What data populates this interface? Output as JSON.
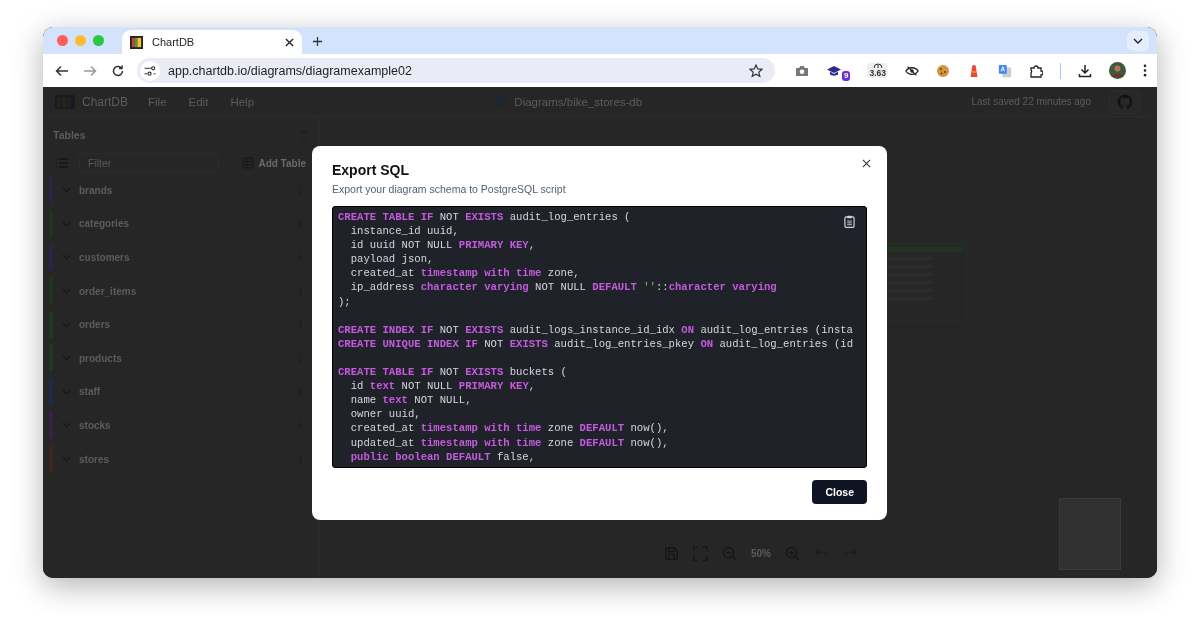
{
  "browser": {
    "tabs": [
      {
        "title": "ChartDB",
        "selected": true
      }
    ],
    "url": "app.chartdb.io/diagrams/diagramexample02",
    "extension_badge": "9",
    "extension_reading": "3.63"
  },
  "app": {
    "brand": "ChartDB",
    "menu": [
      "File",
      "Edit",
      "Help"
    ],
    "diagram_path": "Diagrams/bike_stores-db",
    "last_saved": "Last saved 22 minutes ago"
  },
  "sidebar": {
    "title": "Tables",
    "filter_placeholder": "Filter",
    "add_button": "Add Table",
    "tables": [
      {
        "name": "brands",
        "color": "#2b2444"
      },
      {
        "name": "categories",
        "color": "#1f3522"
      },
      {
        "name": "customers",
        "color": "#26264a"
      },
      {
        "name": "order_items",
        "color": "#21361f"
      },
      {
        "name": "orders",
        "color": "#1e3a22"
      },
      {
        "name": "products",
        "color": "#1e3a22"
      },
      {
        "name": "staff",
        "color": "#26264a"
      },
      {
        "name": "stocks",
        "color": "#3a2244"
      },
      {
        "name": "stores",
        "color": "#3d2620"
      }
    ]
  },
  "canvas": {
    "zoom": "50%"
  },
  "dialog": {
    "title": "Export SQL",
    "subtitle": "Export your diagram schema to PostgreSQL script",
    "code_lines": [
      {
        "kind": "code",
        "tokens": [
          {
            "kind": "keyword",
            "text": "CREATE TABLE IF"
          },
          {
            "kind": "plain",
            "text": " NOT "
          },
          {
            "kind": "keyword",
            "text": "EXISTS"
          },
          {
            "kind": "plain",
            "text": " audit_log_entries ("
          }
        ]
      },
      {
        "kind": "code",
        "tokens": [
          {
            "kind": "plain",
            "text": "  instance_id uuid,"
          }
        ]
      },
      {
        "kind": "code",
        "tokens": [
          {
            "kind": "plain",
            "text": "  id uuid NOT NULL "
          },
          {
            "kind": "keyword",
            "text": "PRIMARY KEY"
          },
          {
            "kind": "plain",
            "text": ","
          }
        ]
      },
      {
        "kind": "code",
        "tokens": [
          {
            "kind": "plain",
            "text": "  payload json,"
          }
        ]
      },
      {
        "kind": "code",
        "tokens": [
          {
            "kind": "plain",
            "text": "  created_at "
          },
          {
            "kind": "keyword",
            "text": "timestamp with time"
          },
          {
            "kind": "plain",
            "text": " zone,"
          }
        ]
      },
      {
        "kind": "code",
        "tokens": [
          {
            "kind": "plain",
            "text": "  ip_address "
          },
          {
            "kind": "keyword",
            "text": "character varying"
          },
          {
            "kind": "plain",
            "text": " NOT NULL "
          },
          {
            "kind": "keyword",
            "text": "DEFAULT"
          },
          {
            "kind": "string",
            "text": " ''"
          },
          {
            "kind": "plain",
            "text": "::"
          },
          {
            "kind": "keyword",
            "text": "character varying"
          }
        ]
      },
      {
        "kind": "code",
        "tokens": [
          {
            "kind": "plain",
            "text": ");"
          }
        ]
      },
      {
        "kind": "blank"
      },
      {
        "kind": "code",
        "tokens": [
          {
            "kind": "keyword",
            "text": "CREATE INDEX IF"
          },
          {
            "kind": "plain",
            "text": " NOT "
          },
          {
            "kind": "keyword",
            "text": "EXISTS"
          },
          {
            "kind": "plain",
            "text": " audit_logs_instance_id_idx "
          },
          {
            "kind": "keyword",
            "text": "ON"
          },
          {
            "kind": "plain",
            "text": " audit_log_entries (insta"
          }
        ]
      },
      {
        "kind": "code",
        "tokens": [
          {
            "kind": "keyword",
            "text": "CREATE UNIQUE INDEX IF"
          },
          {
            "kind": "plain",
            "text": " NOT "
          },
          {
            "kind": "keyword",
            "text": "EXISTS"
          },
          {
            "kind": "plain",
            "text": " audit_log_entries_pkey "
          },
          {
            "kind": "keyword",
            "text": "ON"
          },
          {
            "kind": "plain",
            "text": " audit_log_entries (id"
          }
        ]
      },
      {
        "kind": "blank"
      },
      {
        "kind": "code",
        "tokens": [
          {
            "kind": "keyword",
            "text": "CREATE TABLE IF"
          },
          {
            "kind": "plain",
            "text": " NOT "
          },
          {
            "kind": "keyword",
            "text": "EXISTS"
          },
          {
            "kind": "plain",
            "text": " buckets ("
          }
        ]
      },
      {
        "kind": "code",
        "tokens": [
          {
            "kind": "plain",
            "text": "  id "
          },
          {
            "kind": "keyword",
            "text": "text"
          },
          {
            "kind": "plain",
            "text": " NOT NULL "
          },
          {
            "kind": "keyword",
            "text": "PRIMARY KEY"
          },
          {
            "kind": "plain",
            "text": ","
          }
        ]
      },
      {
        "kind": "code",
        "tokens": [
          {
            "kind": "plain",
            "text": "  name "
          },
          {
            "kind": "keyword",
            "text": "text"
          },
          {
            "kind": "plain",
            "text": " NOT NULL,"
          }
        ]
      },
      {
        "kind": "code",
        "tokens": [
          {
            "kind": "plain",
            "text": "  owner uuid,"
          }
        ]
      },
      {
        "kind": "code",
        "tokens": [
          {
            "kind": "plain",
            "text": "  created_at "
          },
          {
            "kind": "keyword",
            "text": "timestamp with time"
          },
          {
            "kind": "plain",
            "text": " zone "
          },
          {
            "kind": "keyword",
            "text": "DEFAULT"
          },
          {
            "kind": "plain",
            "text": " now(),"
          }
        ]
      },
      {
        "kind": "code",
        "tokens": [
          {
            "kind": "plain",
            "text": "  updated_at "
          },
          {
            "kind": "keyword",
            "text": "timestamp with time"
          },
          {
            "kind": "plain",
            "text": " zone "
          },
          {
            "kind": "keyword",
            "text": "DEFAULT"
          },
          {
            "kind": "plain",
            "text": " now(),"
          }
        ]
      },
      {
        "kind": "code",
        "tokens": [
          {
            "kind": "keyword",
            "text": "  public boolean DEFAULT"
          },
          {
            "kind": "plain",
            "text": " false,"
          }
        ]
      }
    ],
    "close_button": "Close"
  }
}
